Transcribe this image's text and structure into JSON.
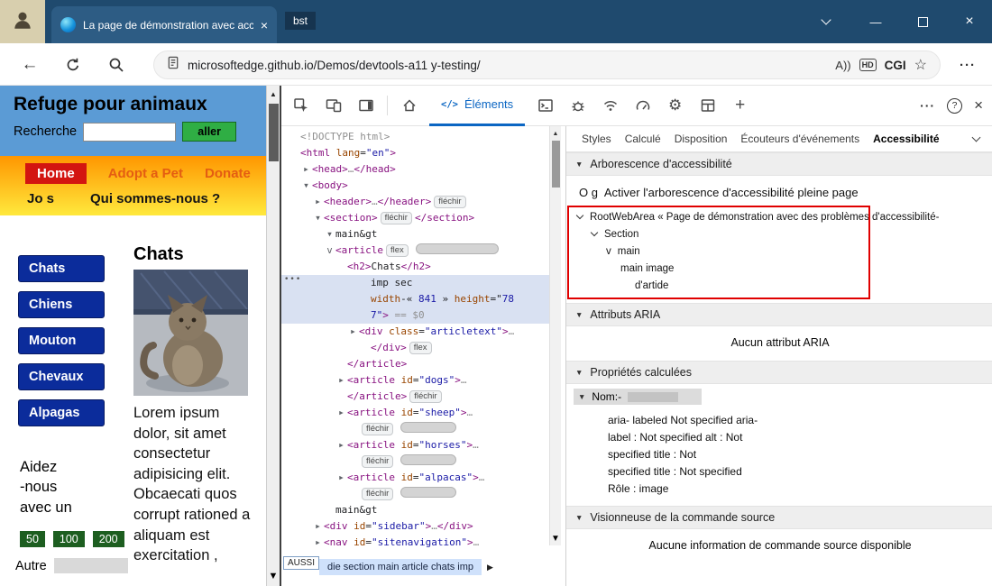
{
  "colors": {
    "header_blue": "#5b9bd5",
    "nav_orange": "#ff9600",
    "nav_yellow": "#ffe93d",
    "home_red": "#d31510",
    "category_navy": "#0b2c9b",
    "amount_green": "#1d5e20",
    "annotation_red": "#e00000",
    "devtools_accent": "#0b66c3",
    "selection_blue": "#d9e1f2"
  },
  "icons": {
    "close": "×",
    "min": "—",
    "star": "☆",
    "more": "···",
    "help": "?",
    "plus": "+",
    "code": "</>",
    "back": "←",
    "gear": "⚙",
    "up": "▲",
    "down": "▼",
    "right": "▶",
    "down_tri": "▼"
  },
  "chrome": {
    "tab_title": "La page de démonstration avec accessibilité est",
    "tab_fragment": "bst",
    "url": "microsoftedge.github.io/Demos/devtools-a11 y-testing/",
    "read_aloud": "A))",
    "hd_badge": "HD",
    "profile_name": "CGI"
  },
  "page": {
    "title": "Refuge pour animaux",
    "search_label": "Recherche",
    "go_button": "aller",
    "nav_row1": [
      "Home",
      "Adopt a Pet",
      "Donate"
    ],
    "nav_row2": [
      "Jo s",
      "Qui sommes-nous ?"
    ],
    "categories": [
      "Chats",
      "Chiens",
      "Mouton",
      "Chevaux",
      "Alpagas"
    ],
    "heading": "Chats",
    "paragraph": "Lorem ipsum dolor, sit amet consectetur adipisicing elit. Obcaecati quos corrupt rationed a aliquam est exercitation ,",
    "aid_lines": [
      "Aidez",
      "-nous",
      "avec un"
    ],
    "amounts": [
      "50",
      "100",
      "200"
    ],
    "other_label": "Autre"
  },
  "devtools": {
    "elements_tab": "Éléments",
    "breadcrumb_note": "AUSSI",
    "breadcrumb": "die section main article chats imp",
    "dom_lines": [
      {
        "ind": 0,
        "tok": [
          [
            "g",
            "<!DOCTYPE html>"
          ]
        ]
      },
      {
        "ind": 0,
        "tok": [
          [
            "t",
            "<html "
          ],
          [
            "a",
            "lang"
          ],
          [
            "p",
            "="
          ],
          [
            "v",
            "\"en\""
          ],
          [
            "t",
            ">"
          ]
        ]
      },
      {
        "ind": 1,
        "ar": "▶",
        "tok": [
          [
            "t",
            "<head>"
          ],
          [
            "g",
            "…"
          ],
          [
            "t",
            "</head>"
          ]
        ]
      },
      {
        "ind": 1,
        "ar": "▼",
        "tok": [
          [
            "t",
            "<body>"
          ]
        ]
      },
      {
        "ind": 2,
        "ar": "▶",
        "tok": [
          [
            "t",
            "<header>"
          ],
          [
            "g",
            "…"
          ],
          [
            "t",
            "</header>"
          ],
          [
            "b",
            "fléchir"
          ]
        ]
      },
      {
        "ind": 2,
        "ar": "▼",
        "tok": [
          [
            "t",
            "<section>"
          ],
          [
            "b",
            "fléchir"
          ],
          [
            "t",
            "</section>"
          ]
        ]
      },
      {
        "ind": 3,
        "ar": "▼",
        "tok": [
          [
            "p",
            "main&gt"
          ]
        ]
      },
      {
        "ind": 3,
        "ar": "v",
        "tok": [
          [
            "t",
            "<article"
          ],
          [
            "b",
            "flex"
          ],
          [
            "x",
            "92"
          ]
        ]
      },
      {
        "ind": 4,
        "tok": [
          [
            "t",
            "<h2>"
          ],
          [
            "p",
            "Chats"
          ],
          [
            "t",
            "</h2>"
          ]
        ]
      },
      {
        "ind": 6,
        "sel": true,
        "dots": true,
        "tok": [
          [
            "p",
            "imp sec"
          ]
        ]
      },
      {
        "ind": 6,
        "sel": true,
        "tok": [
          [
            "a",
            "width"
          ],
          [
            "p",
            "-« "
          ],
          [
            "v",
            "841"
          ],
          [
            "p",
            " » "
          ],
          [
            "a",
            "height"
          ],
          [
            "p",
            "=\""
          ],
          [
            "v",
            "78"
          ]
        ]
      },
      {
        "ind": 6,
        "sel": true,
        "tok": [
          [
            "v",
            "7\""
          ],
          [
            "t",
            ">"
          ],
          [
            "g",
            " == $0"
          ]
        ]
      },
      {
        "ind": 5,
        "ar": "▶",
        "tok": [
          [
            "t",
            "<div "
          ],
          [
            "a",
            "class"
          ],
          [
            "p",
            "="
          ],
          [
            "v",
            "\"articletext\""
          ],
          [
            "t",
            ">"
          ],
          [
            "g",
            "…"
          ]
        ]
      },
      {
        "ind": 6,
        "tok": [
          [
            "t",
            "</div>"
          ],
          [
            "b",
            "flex"
          ]
        ]
      },
      {
        "ind": 4,
        "tok": [
          [
            "t",
            "</article>"
          ]
        ]
      },
      {
        "ind": 4,
        "ar": "▶",
        "tok": [
          [
            "t",
            "<article "
          ],
          [
            "a",
            "id"
          ],
          [
            "p",
            "="
          ],
          [
            "v",
            "\"dogs\""
          ],
          [
            "t",
            ">"
          ],
          [
            "g",
            "…"
          ]
        ]
      },
      {
        "ind": 4,
        "tok": [
          [
            "t",
            "</article>"
          ],
          [
            "b",
            "fléchir"
          ]
        ]
      },
      {
        "ind": 4,
        "ar": "▶",
        "tok": [
          [
            "t",
            "<article "
          ],
          [
            "a",
            "id"
          ],
          [
            "p",
            "="
          ],
          [
            "v",
            "\"sheep\""
          ],
          [
            "t",
            ">"
          ],
          [
            "g",
            "…"
          ]
        ]
      },
      {
        "ind": 5,
        "tok": [
          [
            "b",
            "fléchir"
          ],
          [
            "x",
            "62"
          ]
        ]
      },
      {
        "ind": 4,
        "ar": "▶",
        "tok": [
          [
            "t",
            "<article "
          ],
          [
            "a",
            "id"
          ],
          [
            "p",
            "="
          ],
          [
            "v",
            "\"horses\""
          ],
          [
            "t",
            ">"
          ],
          [
            "g",
            "…"
          ]
        ]
      },
      {
        "ind": 5,
        "tok": [
          [
            "b",
            "fléchir"
          ],
          [
            "x",
            "62"
          ]
        ]
      },
      {
        "ind": 4,
        "ar": "▶",
        "tok": [
          [
            "t",
            "<article "
          ],
          [
            "a",
            "id"
          ],
          [
            "p",
            "="
          ],
          [
            "v",
            "\"alpacas\""
          ],
          [
            "t",
            ">"
          ],
          [
            "g",
            "…"
          ]
        ]
      },
      {
        "ind": 5,
        "tok": [
          [
            "b",
            "fléchir"
          ],
          [
            "x",
            "62"
          ]
        ]
      },
      {
        "ind": 3,
        "tok": [
          [
            "p",
            "main&gt"
          ]
        ]
      },
      {
        "ind": 2,
        "ar": "▶",
        "tok": [
          [
            "t",
            "<div "
          ],
          [
            "a",
            "id"
          ],
          [
            "p",
            "="
          ],
          [
            "v",
            "\"sidebar\""
          ],
          [
            "t",
            ">"
          ],
          [
            "g",
            "…"
          ],
          [
            "t",
            "</div>"
          ]
        ]
      },
      {
        "ind": 2,
        "ar": "▶",
        "tok": [
          [
            "t",
            "<nav "
          ],
          [
            "a",
            "id"
          ],
          [
            "p",
            "="
          ],
          [
            "v",
            "\"sitenavigation\""
          ],
          [
            "t",
            ">"
          ],
          [
            "g",
            "…"
          ]
        ]
      }
    ]
  },
  "a11y": {
    "tabs": [
      "Styles",
      "Calculé",
      "Disposition",
      "Écouteurs d'événements",
      "Accessibilité"
    ],
    "selected_tab": "Accessibilité",
    "sections": {
      "tree": "Arborescence d'accessibilité",
      "aria": "Attributs ARIA",
      "computed": "Propriétés calculées",
      "source": "Visionneuse de la commande source"
    },
    "toggle_glyph": "O g",
    "toggle_label": "Activer l'arborescence d'accessibilité pleine page",
    "tree_rows": [
      {
        "ind": 0,
        "ar": "chev",
        "label": "RootWebArea « Page de démonstration avec des problèmes d'accessibilité-"
      },
      {
        "ind": 1,
        "ar": "chev",
        "label": "Section"
      },
      {
        "ind": 2,
        "ar": "v",
        "label": "main"
      },
      {
        "ind": 3,
        "ar": "",
        "label": "main image"
      },
      {
        "ind": 4,
        "ar": "",
        "label": "d'artide"
      }
    ],
    "aria_empty": "Aucun attribut ARIA",
    "name_label": "Nom:-",
    "computed_lines": [
      "aria- labeled Not specified aria-",
      "label : Not specified alt : Not",
      "specified title : Not",
      "specified title : Not specified",
      "Rôle : image"
    ],
    "source_empty": "Aucune information de commande source disponible"
  }
}
